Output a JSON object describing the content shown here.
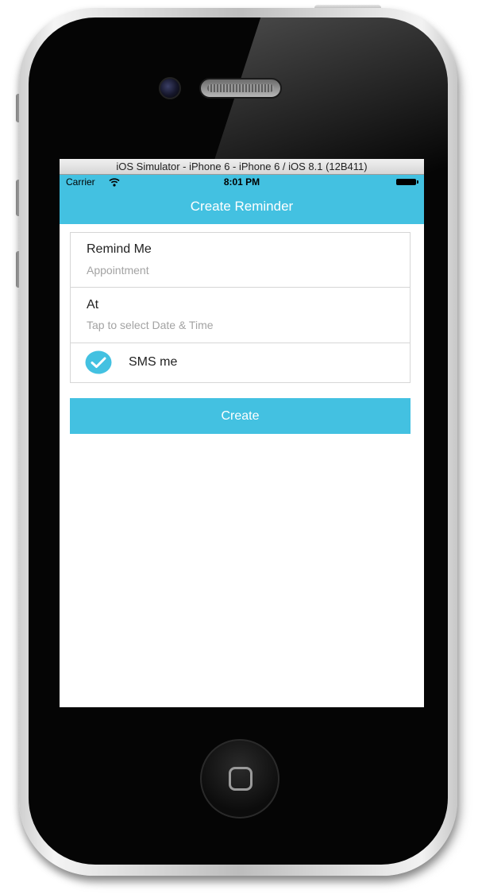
{
  "simulator": {
    "title": "iOS Simulator - iPhone 6 - iPhone 6 / iOS 8.1 (12B411)"
  },
  "status_bar": {
    "carrier": "Carrier",
    "time": "8:01 PM",
    "wifi_icon": "wifi-icon",
    "battery_icon": "battery-icon"
  },
  "nav": {
    "title": "Create Reminder"
  },
  "form": {
    "remind_me": {
      "label": "Remind Me",
      "placeholder": "Appointment"
    },
    "at": {
      "label": "At",
      "placeholder": "Tap to select Date & Time"
    },
    "sms": {
      "label": "SMS me",
      "checked": true,
      "check_icon": "check-circle-icon"
    }
  },
  "actions": {
    "create_label": "Create"
  },
  "colors": {
    "accent": "#43c1e1",
    "placeholder_text": "#a3a3a3",
    "divider": "#d6d6d6"
  }
}
